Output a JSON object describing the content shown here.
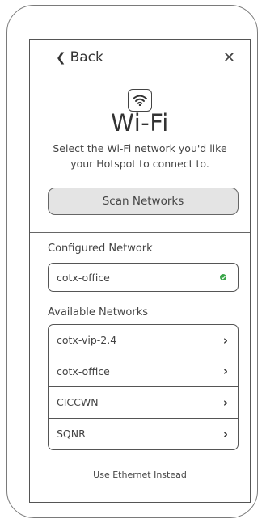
{
  "header": {
    "back_label": "Back",
    "back_icon": "chevron-left-icon",
    "close_icon": "close-icon",
    "close_glyph": "✕"
  },
  "hero": {
    "icon": "wifi-icon",
    "title": "Wi-Fi",
    "subtitle_line1": "Select the Wi-Fi network you'd like",
    "subtitle_line2": "your Hotspot to connect to."
  },
  "scan_button_label": "Scan Networks",
  "configured": {
    "label": "Configured Network",
    "network": "cotx-office",
    "status_icon": "check-circle-icon",
    "status_color": "#3aa64a"
  },
  "available": {
    "label": "Available Networks",
    "networks": [
      "cotx-vip-2.4",
      "cotx-office",
      "CICCWN",
      "SQNR"
    ],
    "row_icon": "chevron-right-icon"
  },
  "footer_link": "Use Ethernet Instead"
}
